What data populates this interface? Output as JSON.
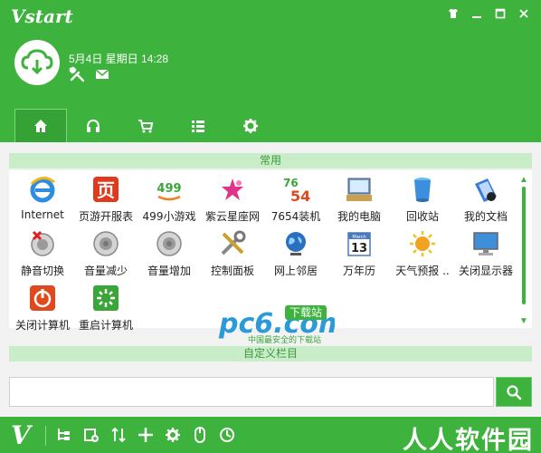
{
  "app": {
    "logo_text": "Vstart"
  },
  "header": {
    "datetime": "5月4日 星期日 14:28",
    "window_controls": [
      "skin-icon",
      "minimize-icon",
      "maximize-icon",
      "close-icon"
    ],
    "tools": [
      "settings-tools-icon",
      "mail-icon"
    ]
  },
  "tabs": [
    {
      "icon": "home-icon",
      "active": true
    },
    {
      "icon": "headphones-icon",
      "active": false
    },
    {
      "icon": "cart-icon",
      "active": false
    },
    {
      "icon": "list-icon",
      "active": false
    },
    {
      "icon": "gear-icon",
      "active": false
    }
  ],
  "sections": {
    "common": "常用",
    "custom": "自定义栏目"
  },
  "apps": [
    {
      "label": "Internet",
      "icon": "ie-icon"
    },
    {
      "label": "页游开服表",
      "icon": "webgame-icon"
    },
    {
      "label": "499小游戏",
      "icon": "game499-icon"
    },
    {
      "label": "紫云星座网",
      "icon": "star-icon"
    },
    {
      "label": "7654装机",
      "icon": "install7654-icon"
    },
    {
      "label": "我的电脑",
      "icon": "computer-icon"
    },
    {
      "label": "回收站",
      "icon": "recycle-bin-icon"
    },
    {
      "label": "我的文档",
      "icon": "documents-icon"
    },
    {
      "label": "静音切换",
      "icon": "mute-icon"
    },
    {
      "label": "音量减少",
      "icon": "volume-down-icon"
    },
    {
      "label": "音量增加",
      "icon": "volume-up-icon"
    },
    {
      "label": "控制面板",
      "icon": "control-panel-icon"
    },
    {
      "label": "网上邻居",
      "icon": "network-icon"
    },
    {
      "label": "万年历",
      "icon": "calendar-icon"
    },
    {
      "label": "天气预报 ..",
      "icon": "weather-icon"
    },
    {
      "label": "关闭显示器",
      "icon": "monitor-off-icon"
    },
    {
      "label": "关闭计算机",
      "icon": "shutdown-icon"
    },
    {
      "label": "重启计算机",
      "icon": "restart-icon"
    }
  ],
  "watermark": {
    "main": "pc6.com",
    "badge": "下载站",
    "sub": "中国最安全的下载站"
  },
  "search": {
    "value": "",
    "placeholder": ""
  },
  "footer": {
    "logo": "V",
    "brand": "人人软件园",
    "icons": [
      "tree-icon",
      "add-page-icon",
      "sort-icon",
      "plus-icon",
      "gear-icon",
      "mouse-icon",
      "clock-icon"
    ]
  },
  "colors": {
    "primary": "#3db33d",
    "strip_bg": "#c9ecc9",
    "strip_text": "#3a9a3a",
    "content_bg": "#f2f2f2"
  },
  "calendar_day": "13",
  "calendar_month": "March"
}
